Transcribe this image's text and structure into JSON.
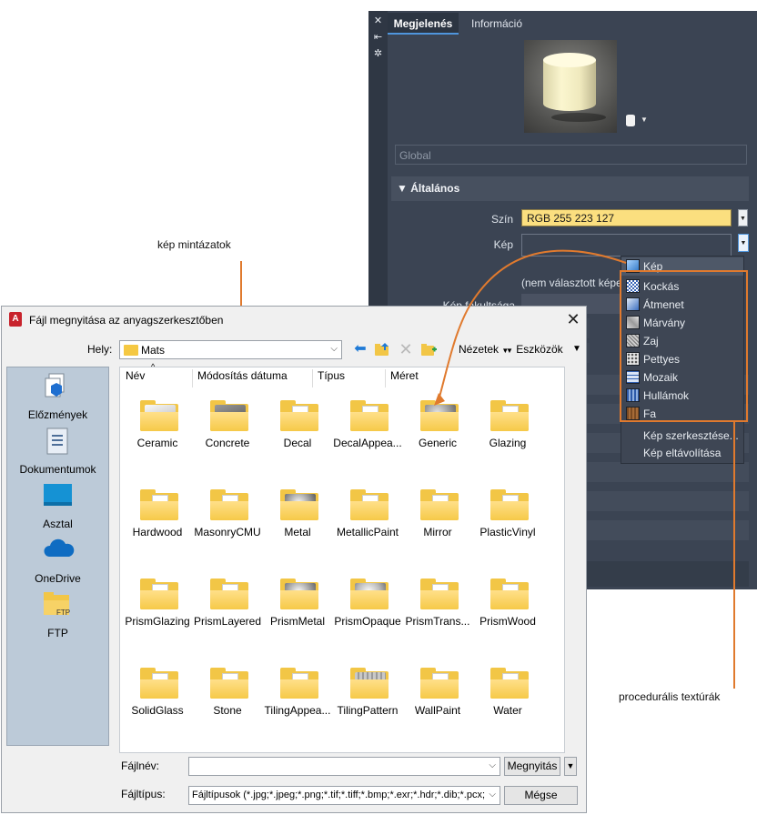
{
  "panel": {
    "tabs": [
      "Megjelenés",
      "Információ"
    ],
    "global_placeholder": "Global",
    "section_general": "Általános",
    "color_label": "Szín",
    "color_value": "RGB 255 223 127",
    "image_label": "Kép",
    "no_image_note": "(nem választott képe",
    "fade_label": "Kép fakultsága",
    "accent_color": "#fbdf7f"
  },
  "image_menu": {
    "items": [
      "Kép",
      "Kockás",
      "Átmenet",
      "Márvány",
      "Zaj",
      "Pettyes",
      "Mozaik",
      "Hullámok",
      "Fa"
    ],
    "edit": "Kép szerkesztése...",
    "remove": "Kép eltávolítása"
  },
  "callouts": {
    "patterns": "kép mintázatok",
    "procedural": "procedurális textúrák",
    "color": "#e07a2e"
  },
  "dialog": {
    "title": "Fájl megnyitása az anyagszerkesztőben",
    "location_label": "Hely:",
    "location_value": "Mats",
    "views": "Nézetek",
    "tools": "Eszközök",
    "places": [
      "Előzmények",
      "Dokumentumok",
      "Asztal",
      "OneDrive",
      "FTP"
    ],
    "columns": [
      "Név",
      "Módosítás dátuma",
      "Típus",
      "Méret"
    ],
    "files": [
      "Ceramic",
      "Concrete",
      "Decal",
      "DecalAppea...",
      "Generic",
      "Glazing",
      "Hardwood",
      "MasonryCMU",
      "Metal",
      "MetallicPaint",
      "Mirror",
      "PlasticVinyl",
      "PrismGlazing",
      "PrismLayered",
      "PrismMetal",
      "PrismOpaque",
      "PrismTrans...",
      "PrismWood",
      "SolidGlass",
      "Stone",
      "TilingAppea...",
      "TilingPattern",
      "WallPaint",
      "Water"
    ],
    "filename_label": "Fájlnév:",
    "filename_value": "",
    "open_button": "Megnyitás",
    "filetype_label": "Fájltípus:",
    "filetype_value": "Fájltípusok (*.jpg;*.jpeg;*.png;*.tif;*.tiff;*.bmp;*.exr;*.hdr;*.dib;*.pcx;*.g",
    "cancel_button": "Mégse"
  }
}
